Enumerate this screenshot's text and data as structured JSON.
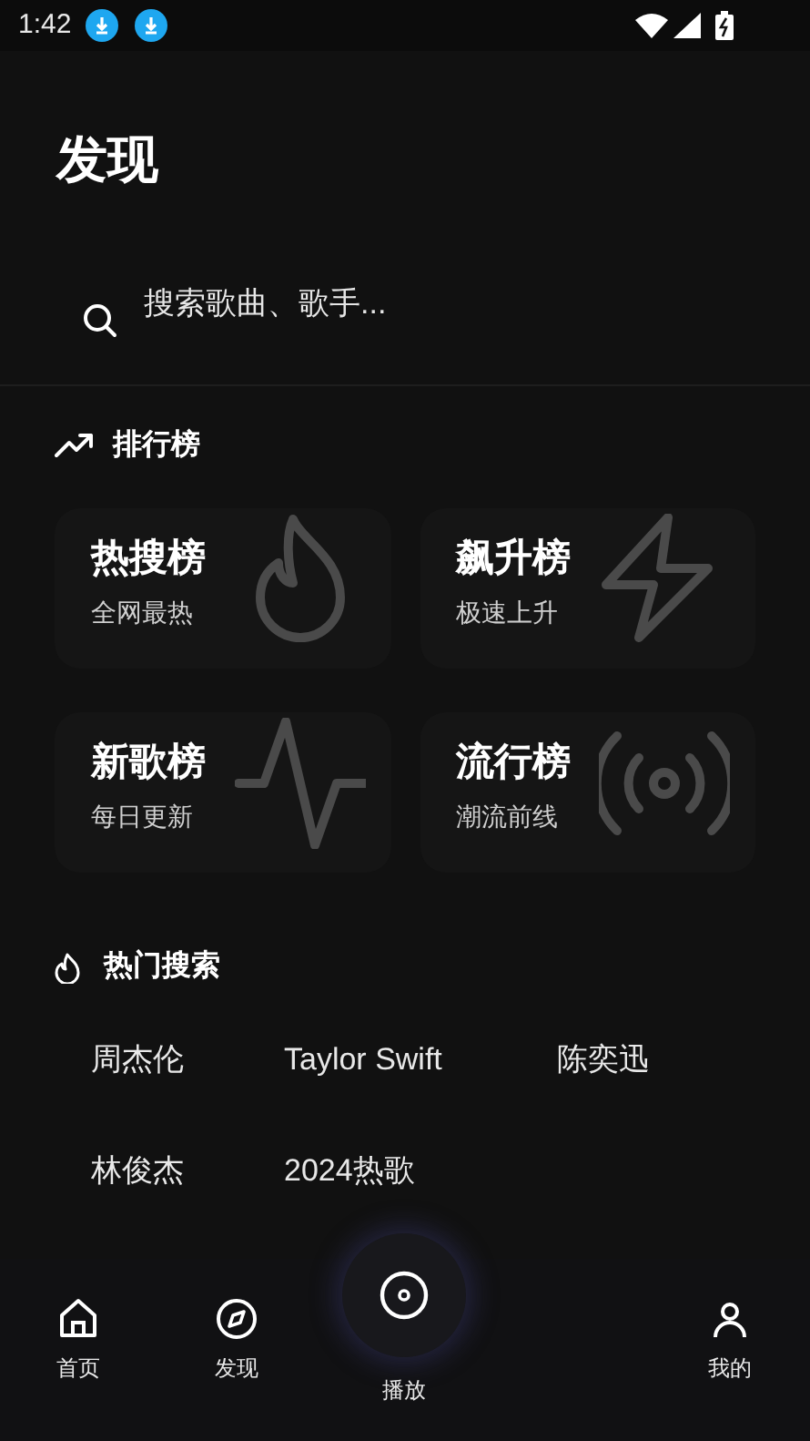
{
  "status_bar": {
    "time": "1:42",
    "notifications": [
      {
        "kind": "download"
      },
      {
        "kind": "download"
      }
    ]
  },
  "title": "发现",
  "search": {
    "placeholder": "搜索歌曲、歌手..."
  },
  "charts_section": {
    "title": "排行榜",
    "cards": [
      {
        "title": "热搜榜",
        "subtitle": "全网最热",
        "kind": "flame"
      },
      {
        "title": "飙升榜",
        "subtitle": "极速上升",
        "kind": "bolt"
      },
      {
        "title": "新歌榜",
        "subtitle": "每日更新",
        "kind": "pulse"
      },
      {
        "title": "流行榜",
        "subtitle": "潮流前线",
        "kind": "broadcast"
      }
    ]
  },
  "hot_search": {
    "title": "热门搜索",
    "terms": [
      "周杰伦",
      "Taylor Swift",
      "陈奕迅",
      "林俊杰",
      "2024热歌"
    ]
  },
  "bottom_nav": [
    {
      "label": "首页",
      "kind": "home"
    },
    {
      "label": "发现",
      "kind": "compass"
    },
    {
      "label": "播放",
      "kind": "play"
    },
    {
      "label": "我的",
      "kind": "profile"
    }
  ]
}
